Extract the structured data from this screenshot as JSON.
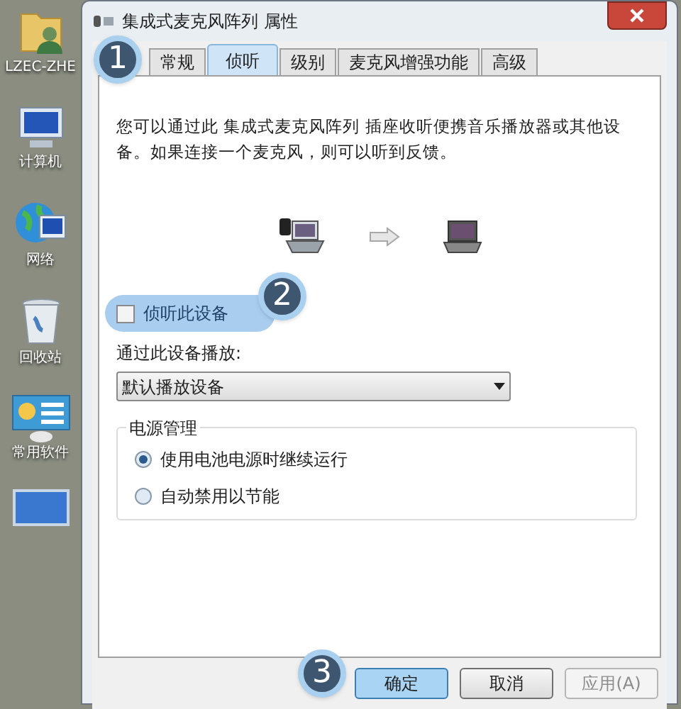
{
  "desktop": {
    "icons": [
      {
        "label": "LZEC-ZHE",
        "kind": "user-folder"
      },
      {
        "label": "计算机",
        "kind": "computer"
      },
      {
        "label": "网络",
        "kind": "network"
      },
      {
        "label": "回收站",
        "kind": "trash"
      },
      {
        "label": "常用软件",
        "kind": "software"
      },
      {
        "kind": "monitor"
      }
    ]
  },
  "window": {
    "title": "集成式麦克风阵列 属性"
  },
  "tabs": [
    {
      "label": "常规",
      "selected": false
    },
    {
      "label": "侦听",
      "selected": true
    },
    {
      "label": "级别",
      "selected": false
    },
    {
      "label": "麦克风增强功能",
      "selected": false
    },
    {
      "label": "高级",
      "selected": false
    }
  ],
  "description": "您可以通过此 集成式麦克风阵列 插座收听便携音乐播放器或其他设备。如果连接一个麦克风，则可以听到反馈。",
  "listen_checkbox": {
    "label": "侦听此设备",
    "checked": false
  },
  "playback": {
    "label": "通过此设备播放:",
    "value": "默认播放设备"
  },
  "power": {
    "title": "电源管理",
    "options": [
      {
        "label": "使用电池电源时继续运行",
        "selected": true
      },
      {
        "label": "自动禁用以节能",
        "selected": false
      }
    ]
  },
  "buttons": [
    {
      "label": "确定",
      "kind": "default"
    },
    {
      "label": "取消",
      "kind": "normal"
    },
    {
      "label": "应用(A)",
      "kind": "disabled"
    }
  ],
  "callouts": [
    {
      "number": "1"
    },
    {
      "number": "2"
    },
    {
      "number": "3"
    }
  ]
}
